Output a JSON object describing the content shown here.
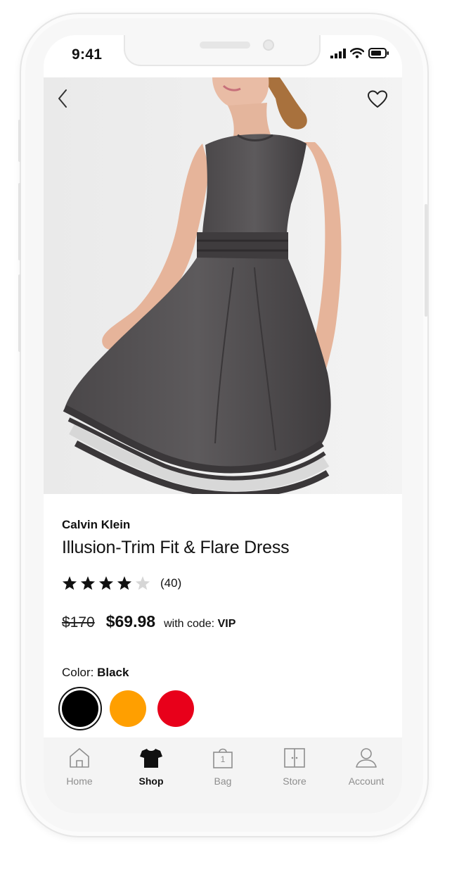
{
  "status_bar": {
    "time": "9:41"
  },
  "product": {
    "brand": "Calvin Klein",
    "name": "Illusion-Trim Fit & Flare Dress",
    "rating": {
      "stars": 4,
      "max_stars": 5,
      "count": "(40)"
    },
    "original_price": "$170",
    "sale_price": "$69.98",
    "promo_text": "with code:",
    "promo_code": "VIP",
    "color_label": "Color:",
    "selected_color": "Black",
    "colors": [
      {
        "name": "Black",
        "hex": "#000000"
      },
      {
        "name": "Orange",
        "hex": "#FF9F00"
      },
      {
        "name": "Red",
        "hex": "#E8001A"
      }
    ],
    "image_pages": 5,
    "image_active_page": 1
  },
  "tab_bar": {
    "items": [
      {
        "label": "Home",
        "icon": "home-icon"
      },
      {
        "label": "Shop",
        "icon": "shirt-icon",
        "active": true
      },
      {
        "label": "Bag",
        "icon": "bag-icon",
        "badge": "1"
      },
      {
        "label": "Store",
        "icon": "store-icon"
      },
      {
        "label": "Account",
        "icon": "account-icon"
      }
    ]
  }
}
